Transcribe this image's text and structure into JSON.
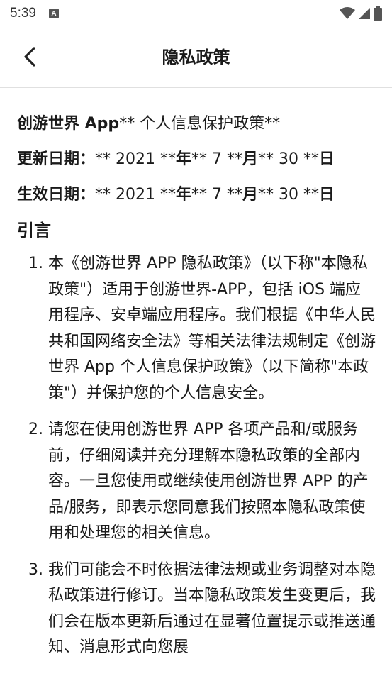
{
  "status_bar": {
    "time": "5:39",
    "app_icon_letter": "A"
  },
  "header": {
    "title": "隐私政策"
  },
  "doc": {
    "line1_bold": "创游世界 App",
    "line1_rest": "** 个人信息保护政策**",
    "update_label": "更新日期：",
    "update_pre": "** 2021 **",
    "update_year": "年",
    "update_mid": "** 7 **",
    "update_month": "月",
    "update_post": "** 30 **",
    "update_day": "日",
    "effective_label": "生效日期：",
    "effective_pre": "** 2021 **",
    "effective_year": "年",
    "effective_mid": "** 7 **",
    "effective_month": "月",
    "effective_post": "** 30 **",
    "effective_day": "日",
    "section_title": "引言",
    "items": [
      {
        "num": "1.",
        "text": "本《创游世界 APP 隐私政策》（以下称\"本隐私政策\"）适用于创游世界-APP，包括 iOS 端应用程序、安卓端应用程序。我们根据《中华人民共和国网络安全法》等相关法律法规制定《创游世界 App 个人信息保护政策》（以下简称\"本政策\"）并保护您的个人信息安全。"
      },
      {
        "num": "2.",
        "text": "请您在使用创游世界 APP 各项产品和/或服务前，仔细阅读并充分理解本隐私政策的全部内容。一旦您使用或继续使用创游世界 APP 的产品/服务，即表示您同意我们按照本隐私政策使用和处理您的相关信息。"
      },
      {
        "num": "3.",
        "text": "我们可能会不时依据法律法规或业务调整对本隐私政策进行修订。当本隐私政策发生变更后，我们会在版本更新后通过在显著位置提示或推送通知、消息形式向您展"
      }
    ]
  }
}
